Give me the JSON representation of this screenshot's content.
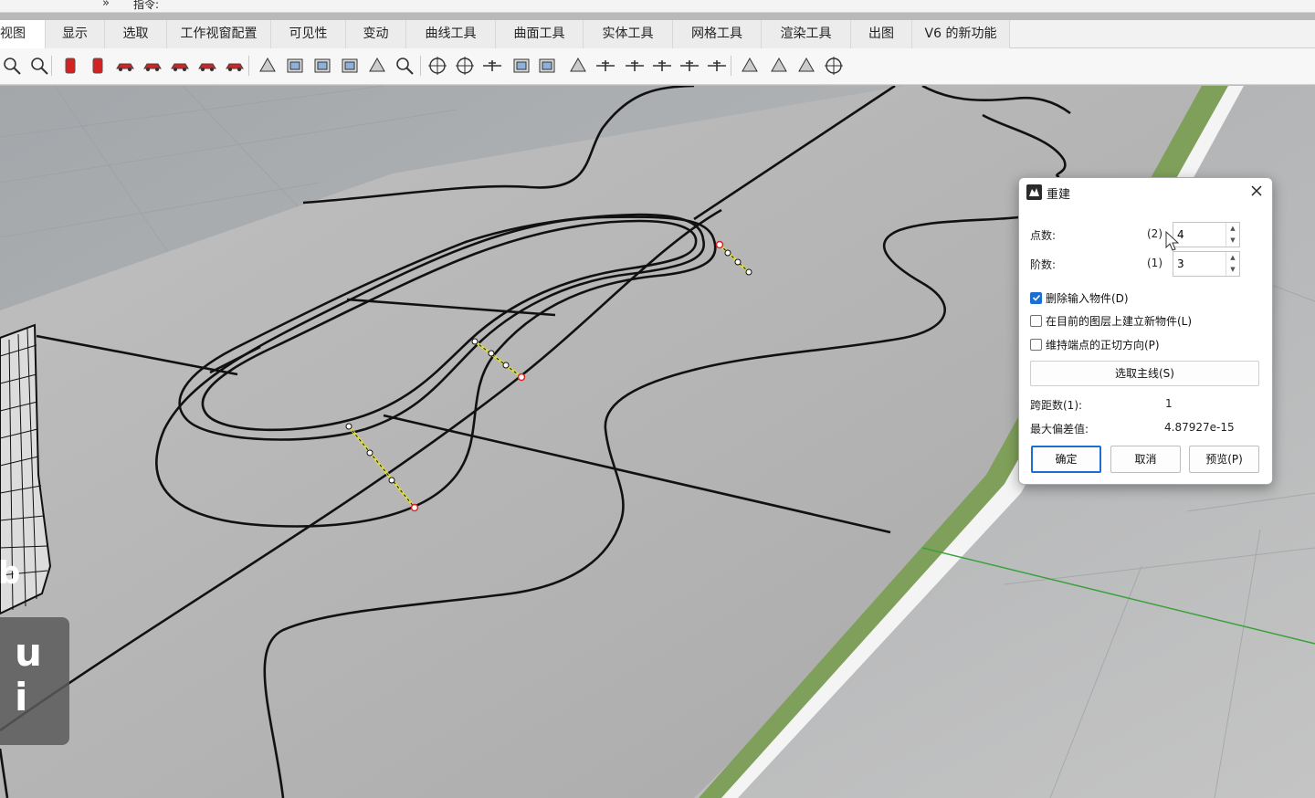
{
  "command_bar": {
    "chevron": "»",
    "prompt": "指令:"
  },
  "tabs": [
    {
      "label": "视图"
    },
    {
      "label": "显示"
    },
    {
      "label": "选取"
    },
    {
      "label": "工作视窗配置"
    },
    {
      "label": "可见性"
    },
    {
      "label": "变动"
    },
    {
      "label": "曲线工具"
    },
    {
      "label": "曲面工具"
    },
    {
      "label": "实体工具"
    },
    {
      "label": "网格工具"
    },
    {
      "label": "渲染工具"
    },
    {
      "label": "出图"
    },
    {
      "label": "V6 的新功能"
    }
  ],
  "toolbar": {
    "icons": [
      "zoom-icon",
      "zoom-extents-icon",
      "red-object-icon",
      "red-column-icon",
      "red-car-icon",
      "red-car-side-icon",
      "red-car-flat-icon",
      "red-car-front-icon",
      "red-car-3d-icon",
      "tilt-view-icon",
      "camera-icon",
      "printer-icon",
      "layout-icon",
      "sphere-icon",
      "two-zoom-icon",
      "target-icon",
      "target-green-icon",
      "elevator-icon",
      "map-icon",
      "cube-icon",
      "walker-icon",
      "stand-icon",
      "aircraft-icon",
      "aircraft-2-icon",
      "aircraft-3-icon",
      "aircraft-4-icon",
      "rotate-icon",
      "walk-icon",
      "sparkle-icon",
      "compass-icon"
    ]
  },
  "watermark": {
    "text": "u i",
    "fragment": "b"
  },
  "dialog": {
    "title": "重建",
    "point_count": {
      "label": "点数:",
      "previous": "(2)",
      "value": "4"
    },
    "degree": {
      "label": "阶数:",
      "previous": "(1)",
      "value": "3"
    },
    "options": [
      {
        "label": "删除输入物件(D)",
        "checked": true
      },
      {
        "label": "在目前的图层上建立新物件(L)",
        "checked": false
      },
      {
        "label": "维持端点的正切方向(P)",
        "checked": false
      }
    ],
    "select_main_curve": "选取主线(S)",
    "span_count": {
      "label": "跨距数(1):",
      "value": "1"
    },
    "max_deviation": {
      "label": "最大偏差值:",
      "value": "4.87927e-15"
    },
    "ok": "确定",
    "cancel": "取消",
    "preview": "预览(P)"
  }
}
